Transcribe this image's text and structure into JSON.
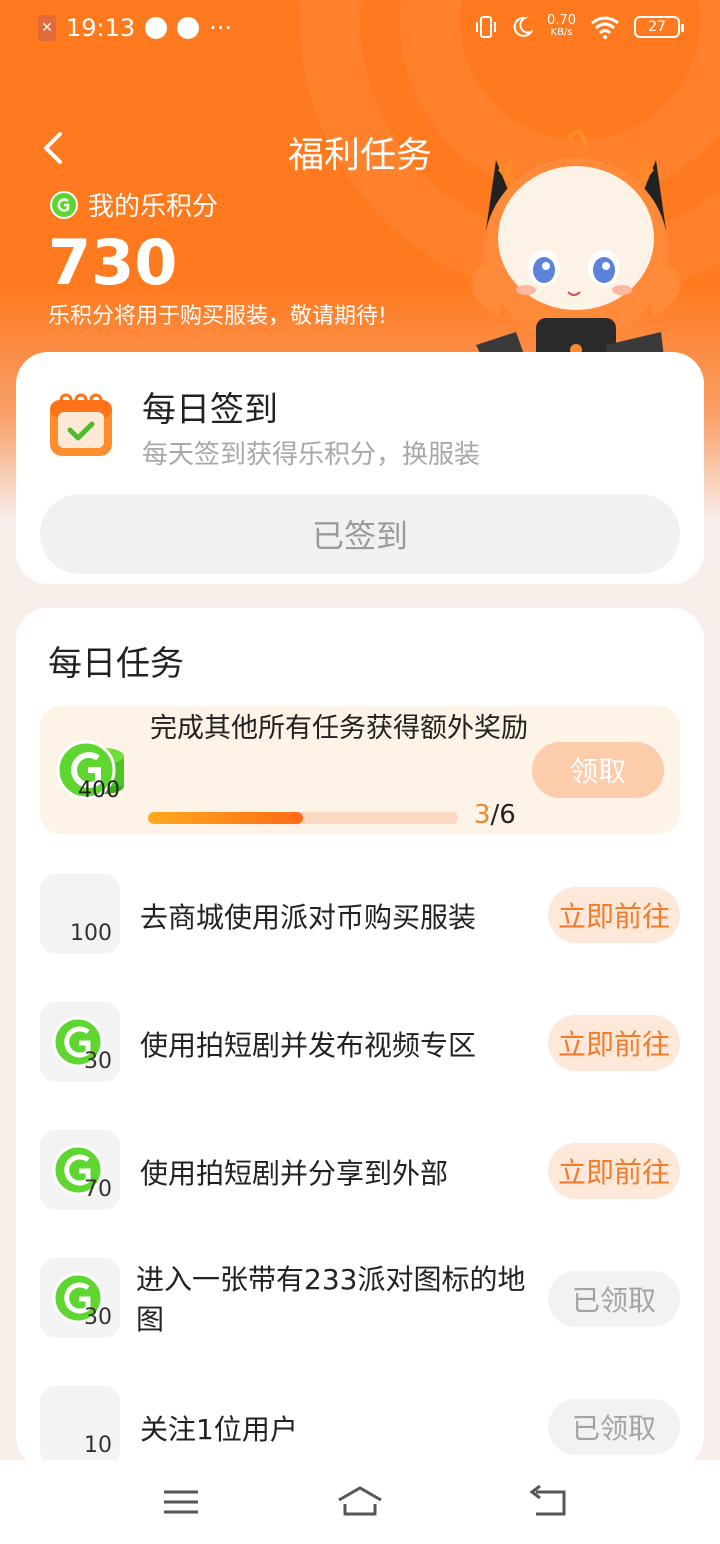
{
  "status_bar": {
    "time": "19:13",
    "net_speed_value": "0.70",
    "net_speed_unit": "KB/s",
    "battery": "27"
  },
  "header": {
    "title": "福利任务",
    "points_label": "我的乐积分",
    "points_value": "730",
    "points_note": "乐积分将用于购买服装，敬请期待!"
  },
  "checkin": {
    "title": "每日签到",
    "desc": "每天签到获得乐积分，换服装",
    "button": "已签到"
  },
  "tasks": {
    "title": "每日任务",
    "bonus": {
      "reward": "400",
      "text": "完成其他所有任务获得额外奖励",
      "progress_current": "3",
      "progress_total": "/6",
      "progress_fraction": 0.5,
      "button": "领取"
    },
    "items": [
      {
        "reward": "100",
        "label": "去商城使用派对币购买服装",
        "button": "立即前往",
        "state": "go",
        "coin": false
      },
      {
        "reward": "30",
        "label": "使用拍短剧并发布视频专区",
        "button": "立即前往",
        "state": "go",
        "coin": true
      },
      {
        "reward": "70",
        "label": "使用拍短剧并分享到外部",
        "button": "立即前往",
        "state": "go",
        "coin": true
      },
      {
        "reward": "30",
        "label": "进入一张带有233派对图标的地图",
        "button": "已领取",
        "state": "done",
        "coin": true
      },
      {
        "reward": "10",
        "label": "关注1位用户",
        "button": "已领取",
        "state": "done",
        "coin": false
      }
    ]
  },
  "icons": {
    "back": "back-arrow-icon",
    "coin": "coin-icon",
    "calendar": "calendar-check-icon",
    "menu": "menu-icon",
    "home": "home-icon",
    "return": "return-icon"
  },
  "colors": {
    "brand": "#ff7a1f",
    "accent_text": "#f57a2a",
    "coin_green": "#5fd62f"
  }
}
